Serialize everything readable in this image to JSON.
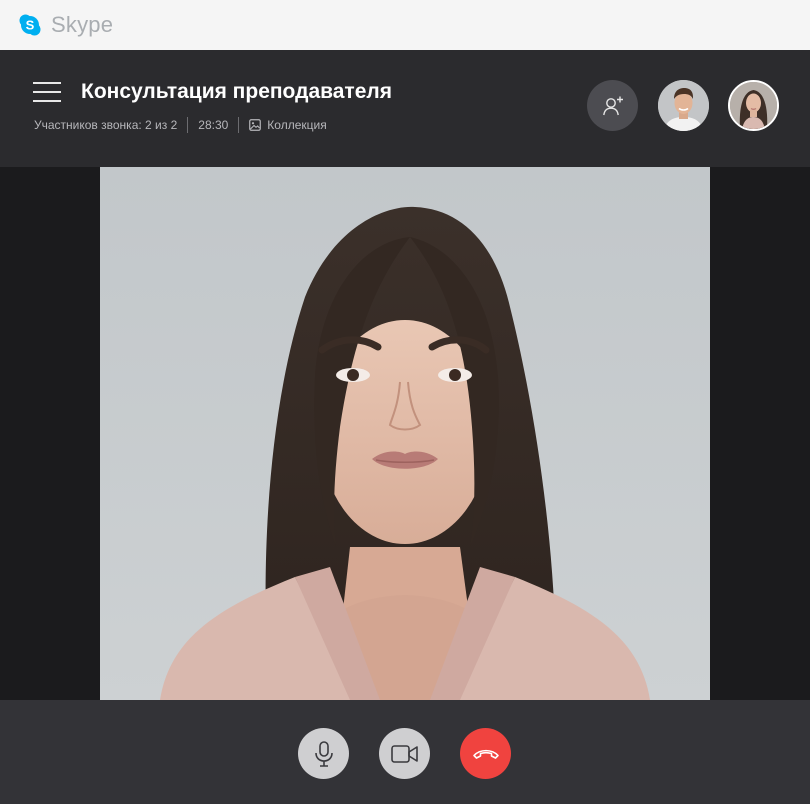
{
  "app": {
    "name": "Skype",
    "accent_color": "#00aff0"
  },
  "call": {
    "title": "Консультация преподавателя",
    "participants_label": "Участников звонка: 2 из 2",
    "duration": "28:30",
    "collection_label": "Коллекция"
  },
  "participants": [
    {
      "avatar": "man-avatar"
    },
    {
      "avatar": "woman-avatar",
      "active": true
    }
  ],
  "controls": {
    "mic_icon": "microphone-icon",
    "camera_icon": "video-camera-icon",
    "end_icon": "hang-up-icon",
    "end_color": "#f0433f"
  }
}
